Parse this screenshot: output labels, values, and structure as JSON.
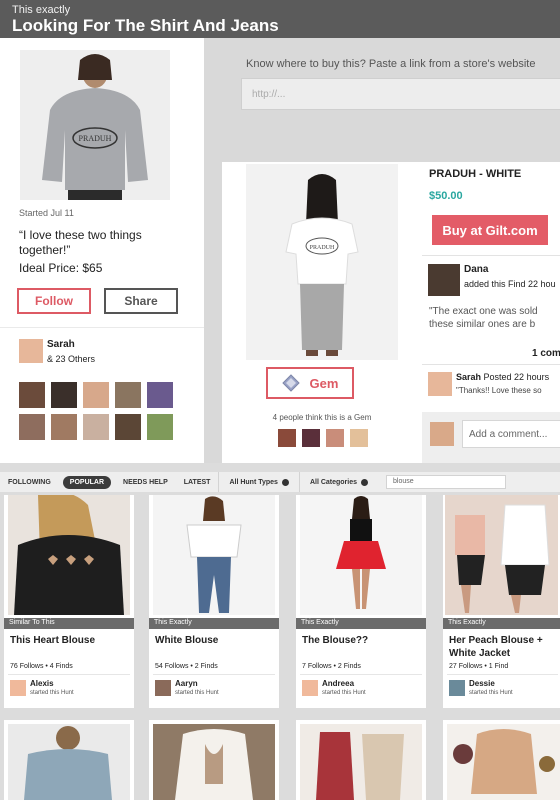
{
  "banner": {
    "eyebrow": "This exactly",
    "headline": "Looking For The Shirt And Jeans"
  },
  "hunt": {
    "started": "Started Jul 11",
    "quote": "“I love these two things together!”",
    "ideal_price": "Ideal Price: $65",
    "follow_label": "Follow",
    "share_label": "Share",
    "follower_name": "Sarah",
    "follower_others": "& 23 Others"
  },
  "paste": {
    "label": "Know where to buy this? Paste a link from a store's website",
    "placeholder": "http://..."
  },
  "product": {
    "title": "PRADUH - WHITE",
    "price": "$50.00",
    "buy_label": "Buy at Gilt.com",
    "finder_name": "Dana",
    "finder_meta": "added this Find 22 hou",
    "snippet_line1": "\"The exact one was sold",
    "snippet_line2": "these similar ones are b",
    "comment_count": "1 com",
    "commenter_name": "Sarah",
    "commenter_meta": "Posted 22 hours",
    "comment_text": "\"Thanks!! Love these so",
    "gem_label": "Gem",
    "gem_note": "4 people think this is a Gem",
    "add_comment_placeholder": "Add a comment..."
  },
  "filters": {
    "following": "FOLLOWING",
    "popular": "POPULAR",
    "needs_help": "NEEDS HELP",
    "latest": "LATEST",
    "hunt_types": "All Hunt Types",
    "categories": "All Categories",
    "search_value": "blouse"
  },
  "cards": [
    {
      "tag": "Similar To This",
      "title": "This Heart Blouse",
      "stats": "76 Follows • 4 Finds",
      "user": "Alexis",
      "started": "started this Hunt"
    },
    {
      "tag": "This Exactly",
      "title": "White Blouse",
      "stats": "54 Follows • 2 Finds",
      "user": "Aaryn",
      "started": "started this Hunt"
    },
    {
      "tag": "This Exactly",
      "title": "The Blouse??",
      "stats": "7 Follows • 2 Finds",
      "user": "Andreea",
      "started": "started this Hunt"
    },
    {
      "tag": "This Exactly",
      "title": "Her Peach Blouse + White Jacket",
      "stats": "27 Follows • 1 Find",
      "user": "Dessie",
      "started": "started this Hunt"
    }
  ],
  "colors": {
    "accent": "#dd5a64",
    "price": "#2aa7a0",
    "banner": "#5b5b5b"
  }
}
